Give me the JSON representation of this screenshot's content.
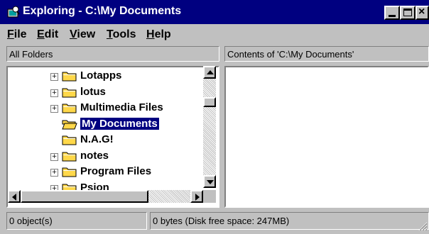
{
  "window": {
    "title": "Exploring - C:\\My Documents"
  },
  "menu": [
    {
      "label": "File",
      "mnemonic": "F",
      "rest": "ile"
    },
    {
      "label": "Edit",
      "mnemonic": "E",
      "rest": "dit"
    },
    {
      "label": "View",
      "mnemonic": "V",
      "rest": "iew"
    },
    {
      "label": "Tools",
      "mnemonic": "T",
      "rest": "ools"
    },
    {
      "label": "Help",
      "mnemonic": "H",
      "rest": "elp"
    }
  ],
  "headers": {
    "folders": "All Folders",
    "contents": "Contents of 'C:\\My Documents'"
  },
  "tree": [
    {
      "label": "Lotapps",
      "expander": "+",
      "selected": false
    },
    {
      "label": "lotus",
      "expander": "+",
      "selected": false
    },
    {
      "label": "Multimedia Files",
      "expander": "+",
      "selected": false
    },
    {
      "label": "My Documents",
      "expander": "",
      "selected": true
    },
    {
      "label": "N.A.G!",
      "expander": "",
      "selected": false
    },
    {
      "label": "notes",
      "expander": "+",
      "selected": false
    },
    {
      "label": "Program Files",
      "expander": "+",
      "selected": false
    },
    {
      "label": "Psion",
      "expander": "+",
      "selected": false
    }
  ],
  "status": {
    "objects": "0 object(s)",
    "space": "0 bytes (Disk free space: 247MB)"
  },
  "colors": {
    "titlebar": "#000080",
    "face": "#c0c0c0",
    "folder": "#ffd84a"
  },
  "icons": [
    "explorer-icon",
    "folder-icon",
    "open-folder-icon",
    "minimize-icon",
    "maximize-icon",
    "close-icon"
  ]
}
